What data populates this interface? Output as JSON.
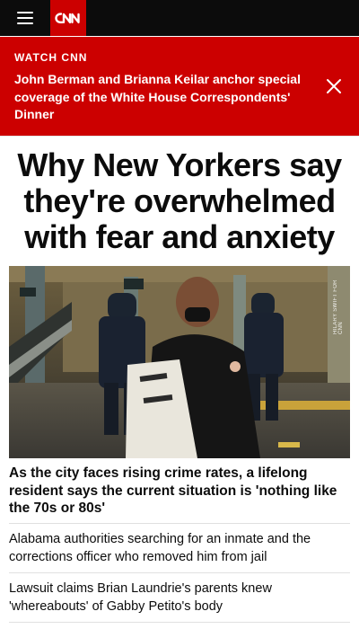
{
  "nav": {
    "menu_icon": "hamburger-menu-icon",
    "logo_text": "CNN",
    "logo_color": "#cc0000"
  },
  "banner": {
    "kicker": "WATCH CNN",
    "headline": "John Berman and Brianna Keilar anchor special coverage of the White House Correspondents' Dinner",
    "close_icon": "close-icon",
    "background": "#cc0000"
  },
  "article": {
    "title": "Why New Yorkers say they're overwhelmed with fear and anxiety",
    "image_credit": "HILARY SWIFT FOR CNN",
    "lead_caption": "As the city faces rising crime rates, a lifelong resident says the current situation is 'nothing like the 70s or 80s'"
  },
  "stories": [
    {
      "text": "Alabama authorities searching for an inmate and the corrections officer who removed him from jail"
    },
    {
      "text": "Lawsuit claims Brian Laundrie's parents knew 'whereabouts' of Gabby Petito's body"
    }
  ]
}
